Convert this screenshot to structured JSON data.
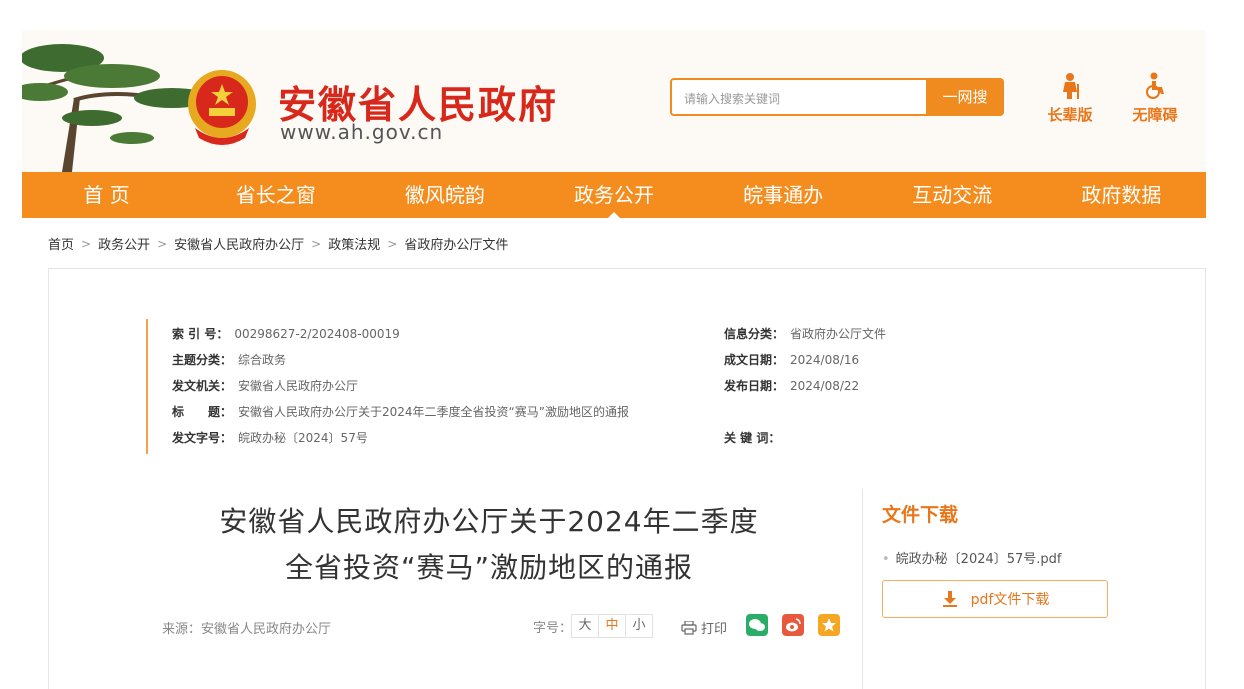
{
  "header": {
    "site_title": "安徽省人民政府",
    "site_url": "www.ah.gov.cn",
    "search": {
      "placeholder": "请输入搜索关键词",
      "button_label": "一网搜"
    },
    "tools": [
      {
        "label": "长辈版",
        "icon": "elder-person-icon"
      },
      {
        "label": "无障碍",
        "icon": "wheelchair-icon"
      }
    ]
  },
  "nav": {
    "items": [
      "首 页",
      "省长之窗",
      "徽风皖韵",
      "政务公开",
      "皖事通办",
      "互动交流",
      "政府数据"
    ],
    "active_index": 3
  },
  "breadcrumb": [
    "首页",
    "政务公开",
    "安徽省人民政府办公厅",
    "政策法规",
    "省政府办公厅文件"
  ],
  "meta": {
    "index_no": {
      "label": "索 引 号：",
      "value": "00298627-2/202408-00019"
    },
    "topic": {
      "label": "主题分类：",
      "value": "综合政务"
    },
    "issuer": {
      "label": "发文机关：",
      "value": "安徽省人民政府办公厅"
    },
    "title": {
      "label": "标　　题：",
      "value": "安徽省人民政府办公厅关于2024年二季度全省投资“赛马”激励地区的通报"
    },
    "doc_no": {
      "label": "发文字号：",
      "value": "皖政办秘〔2024〕57号"
    },
    "info_category": {
      "label": "信息分类：",
      "value": "省政府办公厅文件"
    },
    "written_date": {
      "label": "成文日期：",
      "value": "2024/08/16"
    },
    "published_date": {
      "label": "发布日期：",
      "value": "2024/08/22"
    },
    "keywords": {
      "label": "关 键 词：",
      "value": ""
    }
  },
  "article": {
    "title_line1": "安徽省人民政府办公厅关于2024年二季度",
    "title_line2": "全省投资“赛马”激励地区的通报",
    "source": "来源：安徽省人民政府办公厅",
    "font_size_label": "字号：",
    "font_sizes": [
      "大",
      "中",
      "小"
    ],
    "print_label": "打印"
  },
  "download": {
    "title": "文件下载",
    "file_name": "皖政办秘〔2024〕57号.pdf",
    "button_label": "pdf文件下载"
  },
  "colors": {
    "accent": "#f58d1e",
    "brand_red": "#d8281b",
    "text_orange": "#e8761a"
  }
}
